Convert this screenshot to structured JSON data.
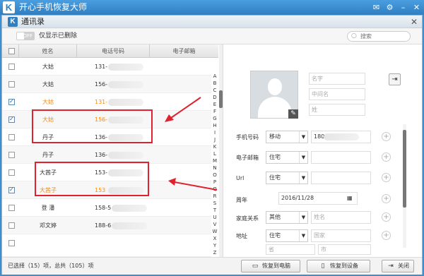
{
  "app": {
    "title": "开心手机恢复大师",
    "logo": "K"
  },
  "dialog": {
    "title": "通讯录",
    "logo": "K"
  },
  "toolbar": {
    "toggle_label": "OFF",
    "filter_label": "仅显示已删除",
    "search_placeholder": "搜索"
  },
  "table": {
    "headers": {
      "name": "姓名",
      "phone": "电话号码",
      "email": "电子邮箱"
    },
    "rows": [
      {
        "name": "大姑",
        "phone": "131-",
        "checked": false,
        "orange": false
      },
      {
        "name": "大姑",
        "phone": "156-",
        "checked": false,
        "orange": false
      },
      {
        "name": "大姑",
        "phone": "131-",
        "checked": true,
        "orange": true
      },
      {
        "name": "大姑",
        "phone": "156-",
        "checked": true,
        "orange": true
      },
      {
        "name": "丹子",
        "phone": "136-",
        "checked": false,
        "orange": false
      },
      {
        "name": "丹子",
        "phone": "136-",
        "checked": false,
        "orange": false
      },
      {
        "name": "大茜子",
        "phone": "153-",
        "checked": false,
        "orange": false
      },
      {
        "name": "大茜子",
        "phone": "153",
        "checked": true,
        "orange": true
      },
      {
        "name": "登 潘",
        "phone": "158-5",
        "checked": false,
        "orange": false
      },
      {
        "name": "邓文婷",
        "phone": "188-6",
        "checked": false,
        "orange": false
      }
    ],
    "alphabet": [
      "A",
      "B",
      "C",
      "D",
      "E",
      "F",
      "G",
      "H",
      "I",
      "J",
      "K",
      "L",
      "M",
      "N",
      "O",
      "P",
      "Q",
      "R",
      "S",
      "T",
      "U",
      "V",
      "W",
      "X",
      "Y",
      "Z"
    ]
  },
  "detail": {
    "name_placeholders": [
      "名字",
      "中间名",
      "姓"
    ],
    "fields": {
      "mobile": {
        "label": "手机号码",
        "type": "移动",
        "value": "180-"
      },
      "email": {
        "label": "电子邮箱",
        "type": "住宅",
        "value": ""
      },
      "url": {
        "label": "Url",
        "type": "住宅",
        "value": ""
      },
      "anniversary": {
        "label": "周年",
        "value": "2016/11/28"
      },
      "relation": {
        "label": "家庭关系",
        "type": "其他",
        "placeholder": "姓名"
      },
      "address": {
        "label": "地址",
        "type": "住宅",
        "country_placeholder": "国家",
        "province_placeholder": "省",
        "city_placeholder": "市"
      }
    }
  },
  "footer": {
    "status": "已选择（15）项，总共（105）项",
    "restore_pc": "恢复到电脑",
    "restore_device": "恢复到设备",
    "close": "关闭"
  },
  "colors": {
    "accent_orange": "#f08c1a",
    "highlight_red": "#e0212e",
    "title_blue": "#2f7fc2"
  }
}
